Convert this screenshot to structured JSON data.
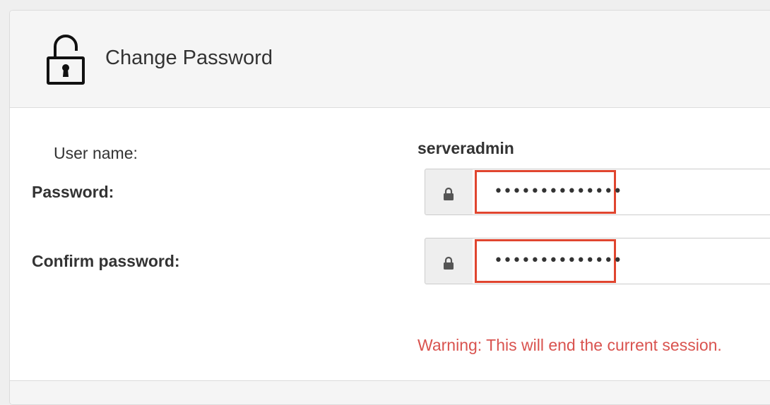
{
  "header": {
    "title": "Change Password",
    "icon": "unlocked-padlock-icon"
  },
  "form": {
    "username_label": "User name:",
    "username_value": "serveradmin",
    "password_label": "Password:",
    "password_value": "••••••••••••••",
    "confirm_label": "Confirm password:",
    "confirm_value": "••••••••••••••",
    "field_icon": "lock-icon",
    "highlight_color": "#e0452f"
  },
  "warning": {
    "text": "Warning: This will end the current session.",
    "color": "#d9534f"
  }
}
